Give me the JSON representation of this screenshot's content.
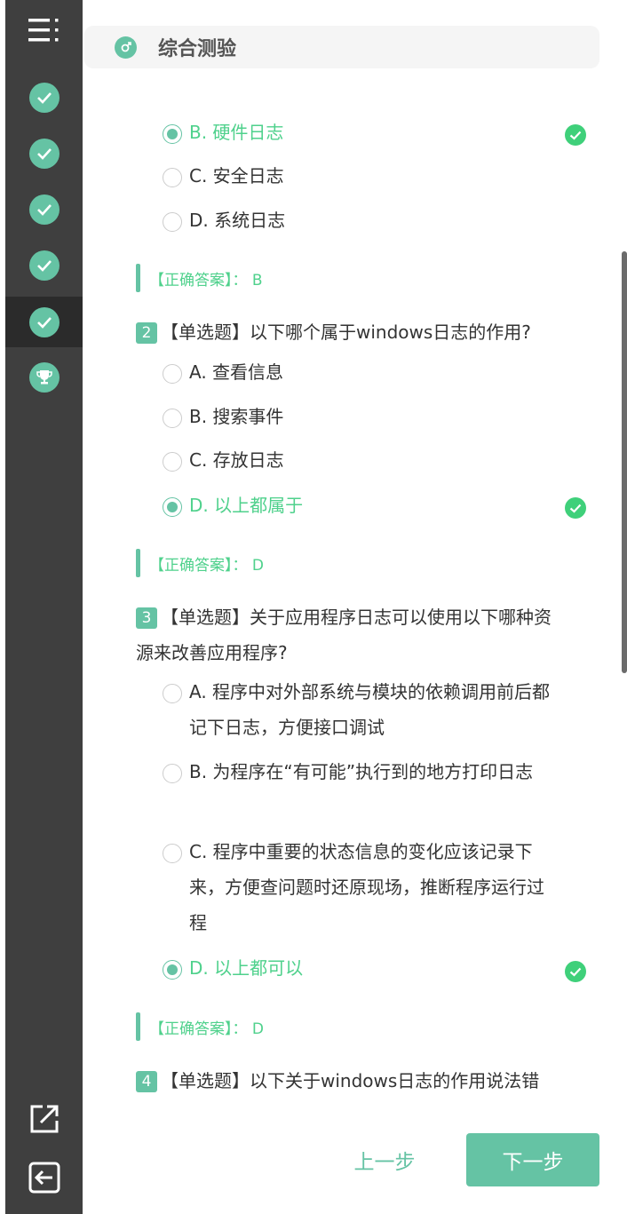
{
  "header": {
    "title": "综合测验"
  },
  "sidebar": {
    "items": [
      {
        "icon": "menu-icon"
      },
      {
        "icon": "check-icon",
        "state": "completed"
      },
      {
        "icon": "check-icon",
        "state": "completed"
      },
      {
        "icon": "check-icon",
        "state": "completed"
      },
      {
        "icon": "check-icon",
        "state": "completed"
      },
      {
        "icon": "check-icon",
        "state": "completed-active"
      },
      {
        "icon": "trophy-icon"
      }
    ],
    "bottom": [
      {
        "icon": "share-icon"
      },
      {
        "icon": "exit-icon"
      }
    ]
  },
  "q1": {
    "options": [
      {
        "label": "B. 硬件日志",
        "selected": true,
        "correct": true
      },
      {
        "label": "C. 安全日志"
      },
      {
        "label": "D. 系统日志"
      }
    ],
    "answer": "【正确答案】： B"
  },
  "q2": {
    "num": "2",
    "text": "【单选题】以下哪个属于windows日志的作用?",
    "options": [
      {
        "label": "A. 查看信息"
      },
      {
        "label": "B. 搜索事件"
      },
      {
        "label": "C. 存放日志"
      },
      {
        "label": "D. 以上都属于",
        "selected": true,
        "correct": true
      }
    ],
    "answer": "【正确答案】： D"
  },
  "q3": {
    "num": "3",
    "text": "【单选题】关于应用程序日志可以使用以下哪种资源来改善应用程序?",
    "options": [
      {
        "label": "A. 程序中对外部系统与模块的依赖调用前后都记下日志，方便接口调试"
      },
      {
        "label": "B. 为程序在“有可能”执行到的地方打印日志"
      },
      {
        "label": "C. 程序中重要的状态信息的变化应该记录下来，方便查问题时还原现场，推断程序运行过程"
      },
      {
        "label": "D. 以上都可以",
        "selected": true,
        "correct": true
      }
    ],
    "answer": "【正确答案】： D"
  },
  "q4": {
    "num": "4",
    "text": "【单选题】以下关于windows日志的作用说法错"
  },
  "footer": {
    "prev": "上一步",
    "next": "下一步"
  },
  "colors": {
    "accent": "#65c3a4",
    "correct": "#3fd07a",
    "sidebar": "#3f3f3f"
  }
}
